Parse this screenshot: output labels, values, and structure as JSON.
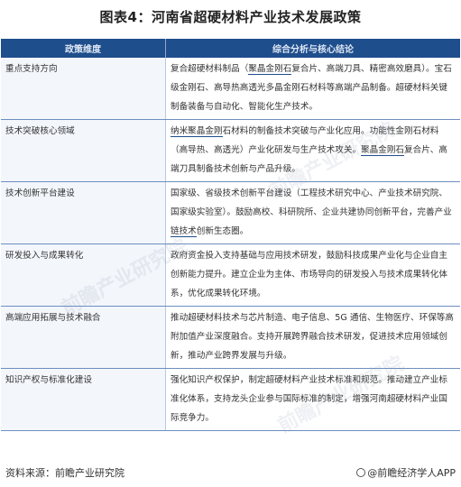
{
  "title": "图表4：河南省超硬材料产业技术发展政策",
  "table": {
    "headers": [
      "政策维度",
      "综合分析与核心结论"
    ],
    "rows": [
      {
        "dimension": "重点支持方向",
        "segments": [
          {
            "text": "复合超硬材料制品（",
            "u": false
          },
          {
            "text": "聚晶金刚石",
            "u": true
          },
          {
            "text": "复合片、高端刀具、精密高效磨具）。宝石级金刚石、高导热高透光多晶金刚石材料等高端产品制备。超硬材料关键制备装备与自动化、智能化生产技术。",
            "u": false
          }
        ]
      },
      {
        "dimension": "技术突破核心领域",
        "segments": [
          {
            "text": "纳米聚晶金刚",
            "u": true
          },
          {
            "text": "石材料的制备技术突破与产业化应用。功能性金刚石材料（高导热、高透光）产业化研发与生产技术攻关。",
            "u": false
          },
          {
            "text": "聚晶金刚石",
            "u": true
          },
          {
            "text": "复合片、高端刀具制备技术创新与产品升级。",
            "u": false
          }
        ]
      },
      {
        "dimension": "技术创新平台建设",
        "segments": [
          {
            "text": "国家级、省级技术创新平台建设（工程技术研究中心、产业技术研究院、国家级实验室）。鼓励高校、科研院所、企业共建协同创新平台，完善产业",
            "u": false
          },
          {
            "text": "链技术",
            "u": true
          },
          {
            "text": "创新生态圈。",
            "u": false
          }
        ]
      },
      {
        "dimension": "研发投入与成果转化",
        "segments": [
          {
            "text": "政府资金投入支持基础与应用技术研发，鼓励科技成果产业化与企业自主创新能力提升。建立企业为主体、市场导向的研发投入与技术成果转化体系，优化成果转化环境。",
            "u": false
          }
        ]
      },
      {
        "dimension": "高端应用拓展与技术融合",
        "segments": [
          {
            "text": "推动超硬材料技术与芯片制造、电子信息、5G 通信、生物医疗、环保等高附加值产业深度融合。支持开展跨界融合技术研发，促进技术应用领域创新，推动产业跨界发展与升级。",
            "u": false
          }
        ]
      },
      {
        "dimension": "知识产权与标准化建设",
        "segments": [
          {
            "text": "强化知识产权保护，制定超硬材料产业技术标准和规范。推动建立产业标准化体系，支持龙头企业参与国际标准的制定，增强河南超硬材料产业国际竞争力。",
            "u": false
          }
        ]
      }
    ]
  },
  "footer": {
    "source": "资料来源：前瞻产业研究院",
    "brand": "@前瞻经济学人APP"
  }
}
